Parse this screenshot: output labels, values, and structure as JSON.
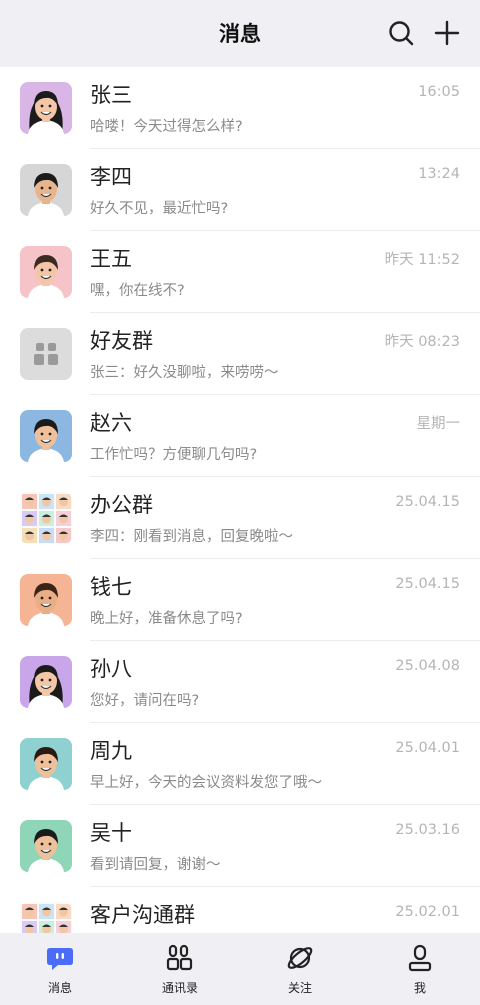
{
  "header": {
    "title": "消息",
    "search_icon": "search-icon",
    "add_icon": "plus-icon"
  },
  "conversations": [
    {
      "name": "张三",
      "message": "哈喽！今天过得怎么样?",
      "time": "16:05",
      "avatar": "woman-dark-hair"
    },
    {
      "name": "李四",
      "message": "好久不见，最近忙吗?",
      "time": "13:24",
      "avatar": "man-smile"
    },
    {
      "name": "王五",
      "message": "嘿，你在线不?",
      "time": "昨天 11:52",
      "avatar": "girl-pink"
    },
    {
      "name": "好友群",
      "message": "张三：好久没聊啦，来唠唠～",
      "time": "昨天 08:23",
      "avatar": "group-placeholder"
    },
    {
      "name": "赵六",
      "message": "工作忙吗？方便聊几句吗?",
      "time": "星期一",
      "avatar": "man-blue"
    },
    {
      "name": "办公群",
      "message": "李四：刚看到消息，回复晚啦～",
      "time": "25.04.15",
      "avatar": "group-grid"
    },
    {
      "name": "钱七",
      "message": "晚上好，准备休息了吗?",
      "time": "25.04.15",
      "avatar": "boy-orange"
    },
    {
      "name": "孙八",
      "message": "您好，请问在吗?",
      "time": "25.04.08",
      "avatar": "woman-purple"
    },
    {
      "name": "周九",
      "message": "早上好，今天的会议资料发您了哦～",
      "time": "25.04.01",
      "avatar": "boy-teal"
    },
    {
      "name": "吴十",
      "message": "看到请回复，谢谢～",
      "time": "25.03.16",
      "avatar": "man-green"
    },
    {
      "name": "客户沟通群",
      "message": "",
      "time": "25.02.01",
      "avatar": "group-grid"
    }
  ],
  "tabs": [
    {
      "label": "消息",
      "icon": "chat-bubble-icon",
      "active": true
    },
    {
      "label": "通讯录",
      "icon": "contacts-icon",
      "active": false
    },
    {
      "label": "关注",
      "icon": "planet-icon",
      "active": false
    },
    {
      "label": "我",
      "icon": "person-icon",
      "active": false
    }
  ],
  "colors": {
    "accent": "#4a6cf7",
    "header_bg": "#efeff4",
    "time": "#b5b5b5",
    "preview": "#8a8a8a"
  }
}
